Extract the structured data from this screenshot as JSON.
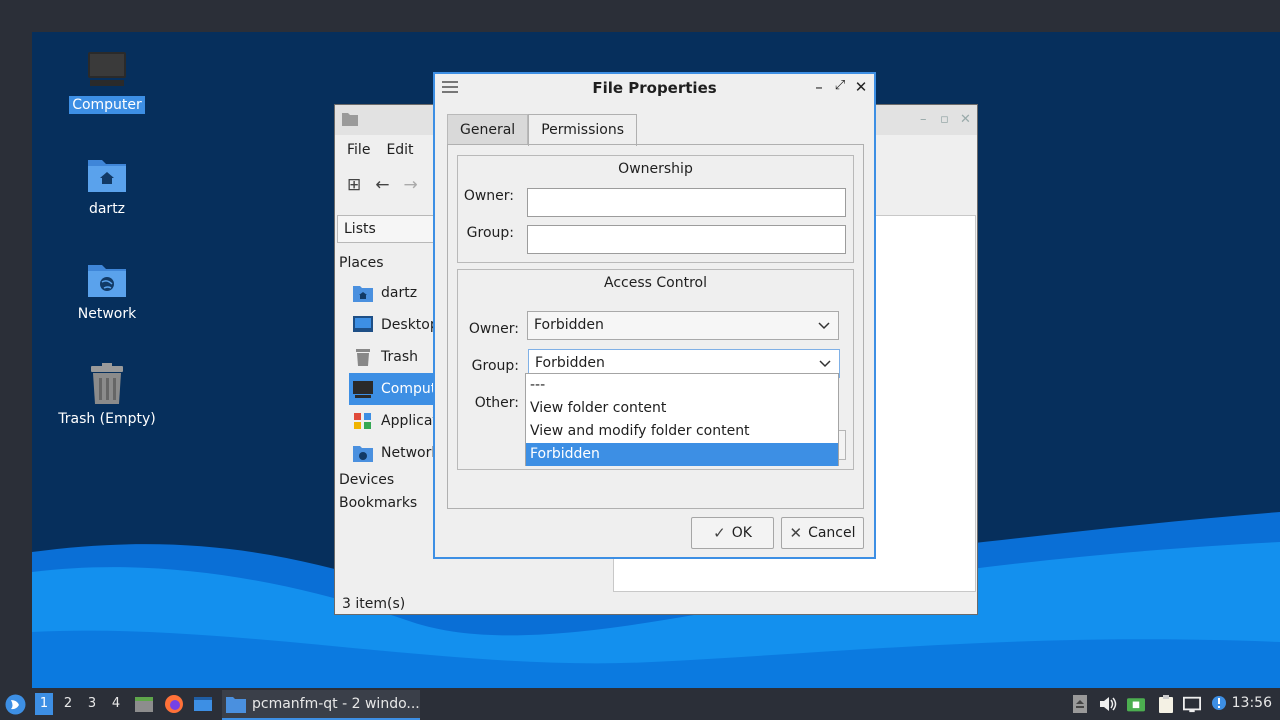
{
  "desktop": {
    "icons": [
      {
        "label": "Computer",
        "icon": "computer-icon"
      },
      {
        "label": "dartz",
        "icon": "home-folder-icon"
      },
      {
        "label": "Network",
        "icon": "network-folder-icon"
      },
      {
        "label": "Trash (Empty)",
        "icon": "trash-icon"
      }
    ]
  },
  "file_manager": {
    "menu": [
      "File",
      "Edit"
    ],
    "side_select": "Lists",
    "places_header": "Places",
    "places": [
      "dartz",
      "Desktop",
      "Trash",
      "Computer",
      "Applications",
      "Network"
    ],
    "devices_header": "Devices",
    "bookmarks_header": "Bookmarks",
    "status": "3 item(s)"
  },
  "dialog": {
    "title": "File Properties",
    "tabs": [
      "General",
      "Permissions"
    ],
    "active_tab": "Permissions",
    "ownership": {
      "title": "Ownership",
      "owner_label": "Owner:",
      "group_label": "Group:",
      "owner_value": "",
      "group_value": ""
    },
    "access": {
      "title": "Access Control",
      "owner_label": "Owner:",
      "group_label": "Group:",
      "other_label": "Other:",
      "owner_value": "Forbidden",
      "group_value": "Forbidden"
    },
    "dropdown_options": [
      "---",
      "View folder content",
      "View and modify folder content",
      "Forbidden"
    ],
    "dropdown_selected": "Forbidden",
    "ok_label": "OK",
    "cancel_label": "Cancel"
  },
  "taskbar": {
    "workspaces": [
      "1",
      "2",
      "3",
      "4"
    ],
    "active_workspace": "1",
    "task_label": "pcmanfm-qt - 2 windo...",
    "clock": "13:56"
  },
  "colors": {
    "accent": "#3d8fe4",
    "desktop_bg": "#062f5c",
    "panel": "#2b2f38"
  }
}
